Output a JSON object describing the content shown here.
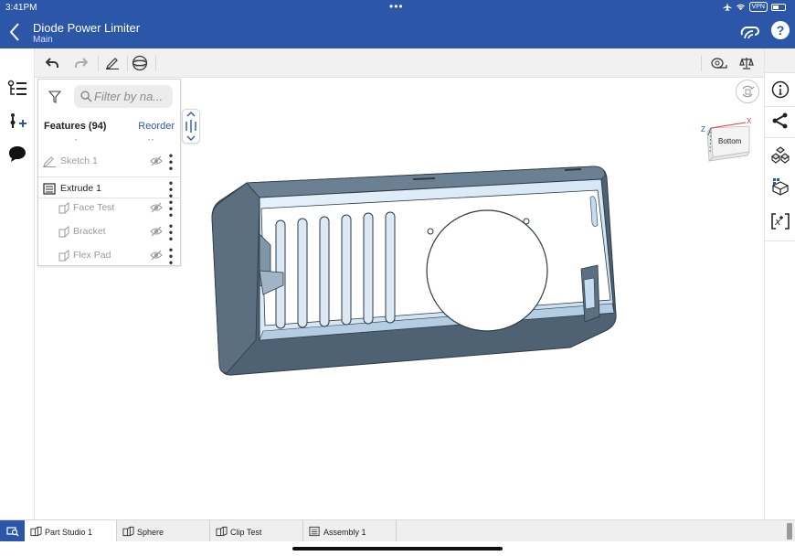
{
  "status_bar": {
    "time": "3:41PM",
    "vpn_label": "VPN",
    "dots": "•••"
  },
  "nav": {
    "title": "Diode Power Limiter",
    "subtitle": "Main",
    "back_icon": "chevron-left-icon",
    "help_label": "?"
  },
  "toolbar": {
    "left_icons": [
      "undo-icon",
      "redo-icon",
      "sketch-pencil-icon",
      "sphere-view-icon"
    ],
    "right_icons": [
      "measure-tape-icon",
      "mass-properties-icon"
    ]
  },
  "left_rail": {
    "icons": [
      "feature-list-icon",
      "insert-feature-icon",
      "comments-icon"
    ]
  },
  "right_rail": {
    "icons": [
      "info-icon",
      "share-icon",
      "parts-icon",
      "configurations-icon",
      "variables-icon"
    ]
  },
  "feature_panel": {
    "search_placeholder": "Filter by na...",
    "features_label": "Features (94)",
    "reorder_label": "Reorder",
    "rows": [
      {
        "label": "Sketch 1",
        "state": "dim",
        "icon": "sketch-icon",
        "hidden_icon": "eye-hidden-icon"
      },
      {
        "label": "Extrude 1",
        "state": "selected",
        "icon": "extrude-icon"
      },
      {
        "label": "Face Test",
        "state": "dim",
        "icon": "part-icon",
        "hidden_icon": "eye-hidden-icon"
      },
      {
        "label": "Bracket",
        "state": "dim",
        "icon": "part-icon",
        "hidden_icon": "eye-hidden-icon"
      },
      {
        "label": "Flex Pad",
        "state": "dim",
        "icon": "part-icon",
        "hidden_icon": "eye-hidden-icon"
      }
    ]
  },
  "view_cube": {
    "face_label": "Bottom",
    "axis_x": "X",
    "axis_z": "Z"
  },
  "colors": {
    "brand": "#2c57a8",
    "model_dark": "#4b5e6f",
    "model_light": "#d6e7f5"
  },
  "tabs": [
    {
      "label": "Part Studio 1",
      "active": true,
      "icon": "part-studio-icon"
    },
    {
      "label": "Sphere",
      "active": false,
      "icon": "part-studio-icon"
    },
    {
      "label": "Clip Test",
      "active": false,
      "icon": "part-studio-icon"
    },
    {
      "label": "Assembly 1",
      "active": false,
      "icon": "assembly-icon"
    }
  ]
}
